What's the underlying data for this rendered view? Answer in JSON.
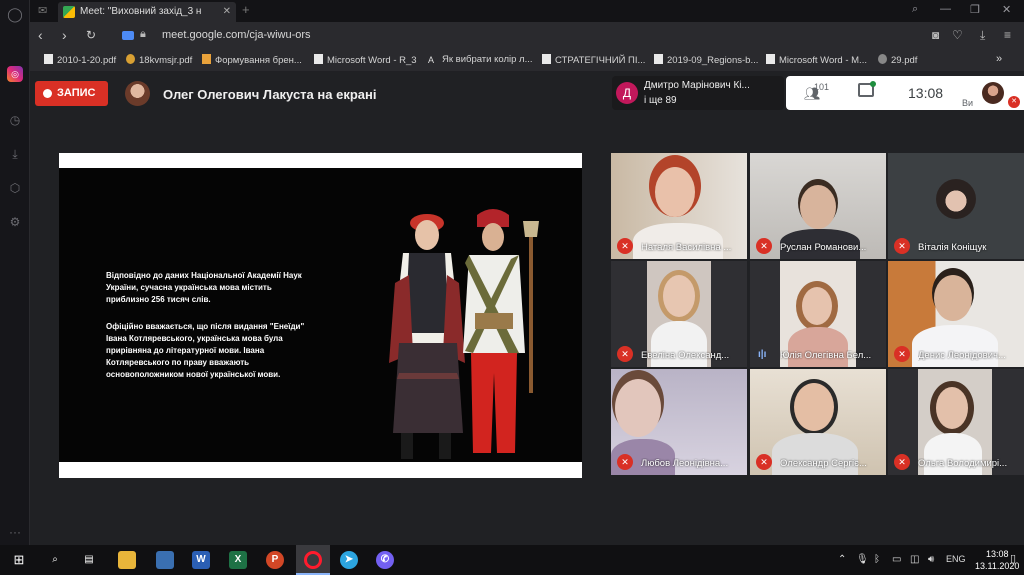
{
  "browser": {
    "tab_title": "Meet: \"Виховний захід_3 н",
    "url": "meet.google.com/cja-wiwu-ors"
  },
  "bookmarks": [
    "2010-1-20.pdf",
    "18kvmsjr.pdf",
    "Формування брен...",
    "Microsoft Word - R_3",
    "Як вибрати колір л...",
    "СТРАТЕГІЧНИЙ ПІ...",
    "2019-09_Regions-b...",
    "Microsoft Word - M...",
    "29.pdf"
  ],
  "meet": {
    "record_label": "ЗАПИС",
    "presenter_title": "Олег Олегович Лакуста на екрані",
    "participant_name": "Дмитро Марінович Кі...",
    "participant_more": "і ще 89",
    "people_count": "101",
    "clock": "13:08",
    "you_label": "Ви"
  },
  "slide": {
    "paragraph1": "Відповідно до даних Національної Академії Наук України, сучасна українська мова містить приблизно 256 тисяч слів.",
    "paragraph2": "Офіційно вважається, що після видання \"Енеїди\" Івана Котляревського, українська мова була прирівняна до літературної мови. Івана Котляревського по праву вважають основоположником нової української мови."
  },
  "participants": [
    {
      "name": "Наталя Василівна ...",
      "muted": true
    },
    {
      "name": "Руслан Романови...",
      "muted": true
    },
    {
      "name": "Віталія Коніщук",
      "muted": true
    },
    {
      "name": "Евеліна Олександ...",
      "muted": true
    },
    {
      "name": "Юлія Олегівна Бел...",
      "muted": false
    },
    {
      "name": "Денис Леонідович...",
      "muted": true
    },
    {
      "name": "Любов Леонідівна...",
      "muted": true
    },
    {
      "name": "Олександр Сергіє...",
      "muted": true
    },
    {
      "name": "Ольга Володимирі...",
      "muted": true
    }
  ],
  "taskbar": {
    "language": "ENG",
    "time": "13:08",
    "date": "13.11.2020"
  },
  "colors": {
    "record": "#d93025",
    "meet_bg": "#202124",
    "pill_avatar": "#c2185b"
  }
}
